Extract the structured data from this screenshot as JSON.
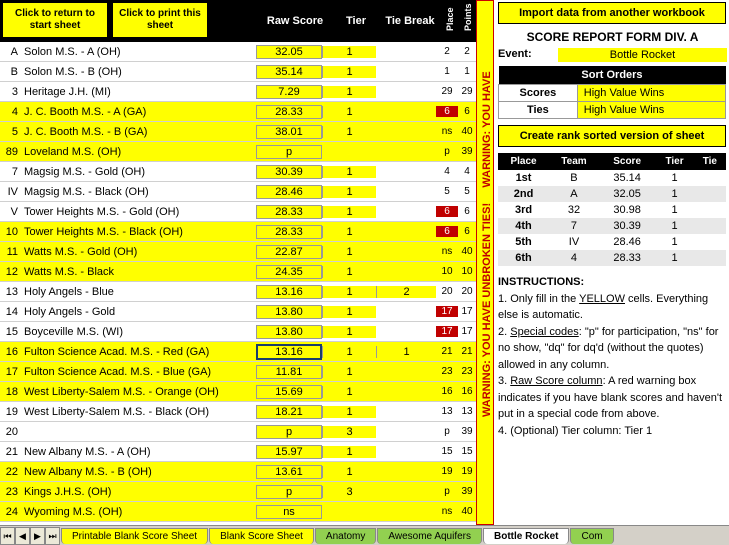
{
  "buttons": {
    "return": "Click to return to start sheet",
    "print": "Click to print this sheet",
    "import": "Import data from another workbook",
    "rank": "Create rank sorted version of sheet"
  },
  "headers": {
    "raw": "Raw Score",
    "tier": "Tier",
    "tie": "Tie Break",
    "place": "Place",
    "points": "Points"
  },
  "rows": [
    {
      "num": "A",
      "team": "Solon M.S. - A (OH)",
      "raw": "32.05",
      "tier": "1",
      "tie": "",
      "place": "2",
      "points": "2",
      "hl": false,
      "red": false
    },
    {
      "num": "B",
      "team": "Solon M.S. - B (OH)",
      "raw": "35.14",
      "tier": "1",
      "tie": "",
      "place": "1",
      "points": "1",
      "hl": false,
      "red": false
    },
    {
      "num": "3",
      "team": "Heritage J.H. (MI)",
      "raw": "7.29",
      "tier": "1",
      "tie": "",
      "place": "29",
      "points": "29",
      "hl": false,
      "red": false
    },
    {
      "num": "4",
      "team": "J. C. Booth M.S. - A (GA)",
      "raw": "28.33",
      "tier": "1",
      "tie": "",
      "place": "6",
      "points": "6",
      "hl": true,
      "red": true
    },
    {
      "num": "5",
      "team": "J. C. Booth M.S. - B (GA)",
      "raw": "38.01",
      "tier": "1",
      "tie": "",
      "place": "ns",
      "points": "40",
      "hl": true,
      "red": false
    },
    {
      "num": "89",
      "team": "Loveland M.S. (OH)",
      "raw": "p",
      "tier": "",
      "tie": "",
      "place": "p",
      "points": "39",
      "hl": true,
      "red": false
    },
    {
      "num": "7",
      "team": "Magsig M.S. - Gold (OH)",
      "raw": "30.39",
      "tier": "1",
      "tie": "",
      "place": "4",
      "points": "4",
      "hl": false,
      "red": false
    },
    {
      "num": "IV",
      "team": "Magsig M.S. - Black (OH)",
      "raw": "28.46",
      "tier": "1",
      "tie": "",
      "place": "5",
      "points": "5",
      "hl": false,
      "red": false
    },
    {
      "num": "V",
      "team": "Tower Heights M.S. - Gold (OH)",
      "raw": "28.33",
      "tier": "1",
      "tie": "",
      "place": "6",
      "points": "6",
      "hl": false,
      "red": true
    },
    {
      "num": "10",
      "team": "Tower Heights M.S. - Black (OH)",
      "raw": "28.33",
      "tier": "1",
      "tie": "",
      "place": "6",
      "points": "6",
      "hl": true,
      "red": true
    },
    {
      "num": "11",
      "team": "Watts M.S. - Gold (OH)",
      "raw": "22.87",
      "tier": "1",
      "tie": "",
      "place": "ns",
      "points": "40",
      "hl": true,
      "red": false
    },
    {
      "num": "12",
      "team": "Watts M.S. - Black",
      "raw": "24.35",
      "tier": "1",
      "tie": "",
      "place": "10",
      "points": "10",
      "hl": true,
      "red": false
    },
    {
      "num": "13",
      "team": "Holy Angels - Blue",
      "raw": "13.16",
      "tier": "1",
      "tie": "2",
      "place": "20",
      "points": "20",
      "hl": false,
      "red": false
    },
    {
      "num": "14",
      "team": "Holy Angels - Gold",
      "raw": "13.80",
      "tier": "1",
      "tie": "",
      "place": "17",
      "points": "17",
      "hl": false,
      "red": true
    },
    {
      "num": "15",
      "team": "Boyceville M.S. (WI)",
      "raw": "13.80",
      "tier": "1",
      "tie": "",
      "place": "17",
      "points": "17",
      "hl": false,
      "red": true
    },
    {
      "num": "16",
      "team": "Fulton Science Acad. M.S. - Red (GA)",
      "raw": "13.16",
      "tier": "1",
      "tie": "1",
      "place": "21",
      "points": "21",
      "hl": true,
      "red": false,
      "selected": true
    },
    {
      "num": "17",
      "team": "Fulton Science Acad. M.S. - Blue (GA)",
      "raw": "11.81",
      "tier": "1",
      "tie": "",
      "place": "23",
      "points": "23",
      "hl": true,
      "red": false
    },
    {
      "num": "18",
      "team": "West Liberty-Salem M.S. - Orange (OH)",
      "raw": "15.69",
      "tier": "1",
      "tie": "",
      "place": "16",
      "points": "16",
      "hl": true,
      "red": false
    },
    {
      "num": "19",
      "team": "West Liberty-Salem M.S. - Black (OH)",
      "raw": "18.21",
      "tier": "1",
      "tie": "",
      "place": "13",
      "points": "13",
      "hl": false,
      "red": false
    },
    {
      "num": "20",
      "team": "",
      "raw": "p",
      "tier": "3",
      "tie": "",
      "place": "p",
      "points": "39",
      "hl": false,
      "red": false
    },
    {
      "num": "21",
      "team": "New Albany M.S. - A (OH)",
      "raw": "15.97",
      "tier": "1",
      "tie": "",
      "place": "15",
      "points": "15",
      "hl": false,
      "red": false
    },
    {
      "num": "22",
      "team": "New Albany M.S. - B (OH)",
      "raw": "13.61",
      "tier": "1",
      "tie": "",
      "place": "19",
      "points": "19",
      "hl": true,
      "red": false
    },
    {
      "num": "23",
      "team": "Kings J.H.S. (OH)",
      "raw": "p",
      "tier": "3",
      "tie": "",
      "place": "p",
      "points": "39",
      "hl": true,
      "red": false
    },
    {
      "num": "24",
      "team": "Wyoming M.S. (OH)",
      "raw": "ns",
      "tier": "",
      "tie": "",
      "place": "ns",
      "points": "40",
      "hl": true,
      "red": false
    }
  ],
  "warning": "WARNING: YOU HAVE UNBROKEN TIES!",
  "warning2": "WARNING: YOU HAVE",
  "report": {
    "title": "SCORE REPORT FORM DIV. A",
    "event_label": "Event:",
    "event_value": "Bottle Rocket"
  },
  "sort": {
    "header": "Sort Orders",
    "scores_label": "Scores",
    "scores_value": "High Value Wins",
    "ties_label": "Ties",
    "ties_value": "High Value Wins"
  },
  "rank_headers": {
    "place": "Place",
    "team": "Team",
    "score": "Score",
    "tier": "Tier",
    "tie": "Tie"
  },
  "rank_rows": [
    {
      "place": "1st",
      "team": "B",
      "score": "35.14",
      "tier": "1",
      "tie": ""
    },
    {
      "place": "2nd",
      "team": "A",
      "score": "32.05",
      "tier": "1",
      "tie": ""
    },
    {
      "place": "3rd",
      "team": "32",
      "score": "30.98",
      "tier": "1",
      "tie": ""
    },
    {
      "place": "4th",
      "team": "7",
      "score": "30.39",
      "tier": "1",
      "tie": ""
    },
    {
      "place": "5th",
      "team": "IV",
      "score": "28.46",
      "tier": "1",
      "tie": ""
    },
    {
      "place": "6th",
      "team": "4",
      "score": "28.33",
      "tier": "1",
      "tie": ""
    }
  ],
  "instructions": {
    "title": "INSTRUCTIONS:",
    "line1a": "1. Only fill in the ",
    "line1b": "YELLOW",
    "line1c": " cells. Everything else is automatic.",
    "line2a": "2. ",
    "line2b": "Special codes",
    "line2c": ": \"p\" for participation, \"ns\" for no show, \"dq\" for dq'd (without the quotes) allowed in any column.",
    "line3a": "3. ",
    "line3b": "Raw Score column",
    "line3c": ": A red warning box indicates if you have blank scores and haven't put in a special code from above.",
    "line4": "4. (Optional) Tier column: Tier 1"
  },
  "tabs": {
    "t1": "Printable Blank Score Sheet",
    "t2": "Blank Score Sheet",
    "t3": "Anatomy",
    "t4": "Awesome Aquifers",
    "t5": "Bottle Rocket",
    "t6": "Com"
  }
}
